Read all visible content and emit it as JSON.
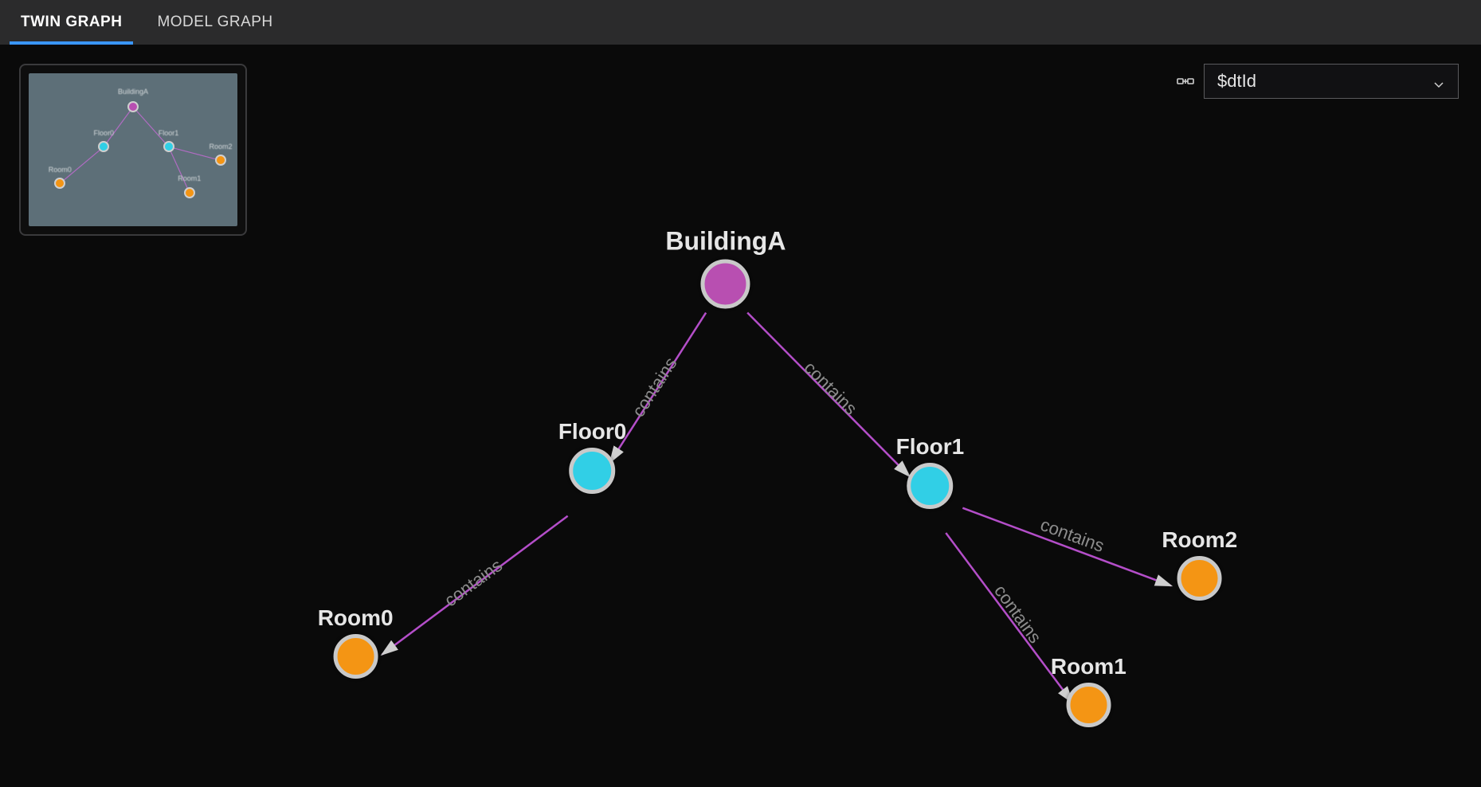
{
  "tabs": {
    "twin_graph": "TWIN GRAPH",
    "model_graph": "MODEL GRAPH",
    "active": "twin_graph"
  },
  "selector": {
    "value": "$dtId"
  },
  "graph": {
    "nodes": {
      "buildingA": {
        "label": "BuildingA",
        "color": "purple"
      },
      "floor0": {
        "label": "Floor0",
        "color": "cyan"
      },
      "floor1": {
        "label": "Floor1",
        "color": "cyan"
      },
      "room0": {
        "label": "Room0",
        "color": "orange"
      },
      "room1": {
        "label": "Room1",
        "color": "orange"
      },
      "room2": {
        "label": "Room2",
        "color": "orange"
      }
    },
    "edges": [
      {
        "from": "buildingA",
        "to": "floor0",
        "label": "contains"
      },
      {
        "from": "buildingA",
        "to": "floor1",
        "label": "contains"
      },
      {
        "from": "floor0",
        "to": "room0",
        "label": "contains"
      },
      {
        "from": "floor1",
        "to": "room1",
        "label": "contains"
      },
      {
        "from": "floor1",
        "to": "room2",
        "label": "contains"
      }
    ]
  },
  "colors": {
    "edge": "#b44ec9",
    "purple": "#b84fb1",
    "cyan": "#31cfe6",
    "orange": "#f49514",
    "accent": "#3a96ff"
  }
}
